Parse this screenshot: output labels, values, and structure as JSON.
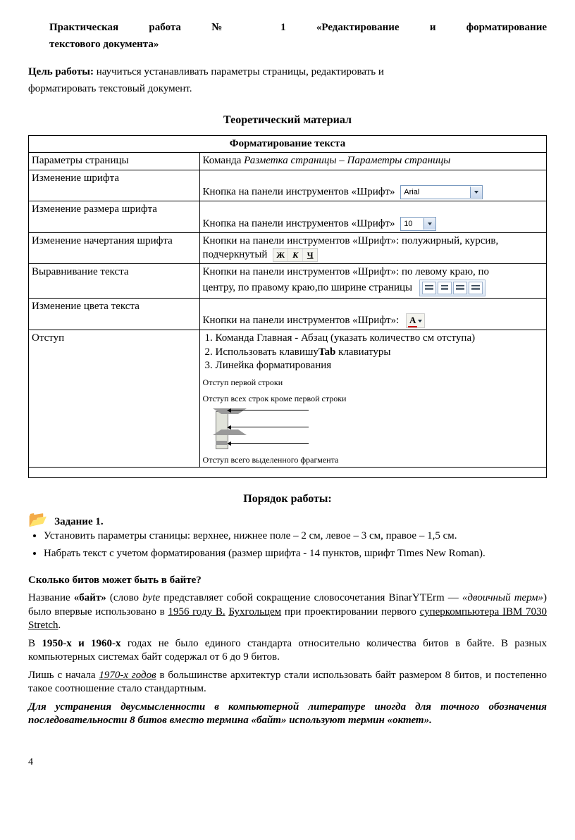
{
  "header": {
    "title_line1": "Практическая   работа   №   1   «Редактирование   и   форматирование",
    "title_line2": "текстового документа»"
  },
  "goal": {
    "label": "Цель работы:",
    "text1": " научиться устанавливать параметры страницы, редактировать и",
    "text2": "форматировать текстовый документ."
  },
  "theory_title": "Теоретический материал",
  "table": {
    "header": "Форматирование текста",
    "rows": {
      "r1": {
        "c1": "Параметры страницы",
        "c2a": "Команда ",
        "c2b": "Разметка страницы – Параметры страницы"
      },
      "r2": {
        "c1": "Изменение шрифта",
        "c2": "Кнопка на панели инструментов «Шрифт» ",
        "font": "Arial"
      },
      "r3": {
        "c1": "Изменение размера шрифта",
        "c2": "Кнопка на панели инструментов «Шрифт» ",
        "size": "10"
      },
      "r4": {
        "c1": "Изменение начертания шрифта",
        "c2a": "Кнопки на панели инструментов «Шрифт»: полужирный, курсив,",
        "c2b": "подчеркнутый "
      },
      "r5": {
        "c1": "Выравнивание текста",
        "c2a": "Кнопки на панели инструментов «Шрифт»: по левому краю, по",
        "c2b": "центру, по правому краю,по ширине страницы "
      },
      "r6": {
        "c1": "Изменение цвета текста",
        "c2": "Кнопки на панели инструментов «Шрифт»: "
      },
      "r7": {
        "c1": "Отступ",
        "li1": "Команда Главная - Абзац (указать количество см отступа)",
        "li2a": "Использовать клавишу",
        "li2b": "Tab",
        "li2c": " клавиатуры",
        "li3": "Линейка форматирования",
        "cap1": "Отступ первой строки",
        "cap2": "Отступ всех строк кроме первой строки",
        "cap3": "Отступ всего выделенного фрагмента"
      }
    }
  },
  "order_title": "Порядок работы:",
  "task1": {
    "title": "Задание 1.",
    "b1": "Установить параметры станицы: верхнее, нижнее поле – 2 см, левое – 3 см, правое – 1,5 см.",
    "b2": "Набрать текст с учетом форматирования (размер шрифта - 14 пунктов, шрифт Times New Roman)."
  },
  "article": {
    "h": "Сколько битов может быть в байте?",
    "p1a": "Название ",
    "p1b": "«байт»",
    "p1c": " (слово ",
    "p1d": "byte",
    "p1e": " представляет собой сокращение словосочетания BinarYTErm — ",
    "p1f": "«двоичный терм»",
    "p1g": ") было впервые использовано в ",
    "p1h": "1956",
    "p1i": " году В.",
    "p1j": " Бухгольцем",
    "p1k": " при проектировании первого ",
    "p1l": "суперкомпьютера",
    "p1m": " IBM 7030 Stretch",
    "p1n": ".",
    "p2a": "В ",
    "p2b": "1950-х и 1960-х",
    "p2c": " годах не было единого стандарта относительно количества битов в байте. В разных компьютерных системах байт содержал от 6 до 9 битов.",
    "p3a": "Лишь с начала ",
    "p3b": "1970-х годов",
    "p3c": " в большинстве архитектур стали использовать байт размером 8 битов, и постепенно такое соотношение стало стандартным.",
    "p4": "Для устранения двусмысленности в компьютерной литературе иногда для точного обозначения последовательности 8 битов вместо термина «байт» используют термин «октет»."
  },
  "pagenum": "4"
}
